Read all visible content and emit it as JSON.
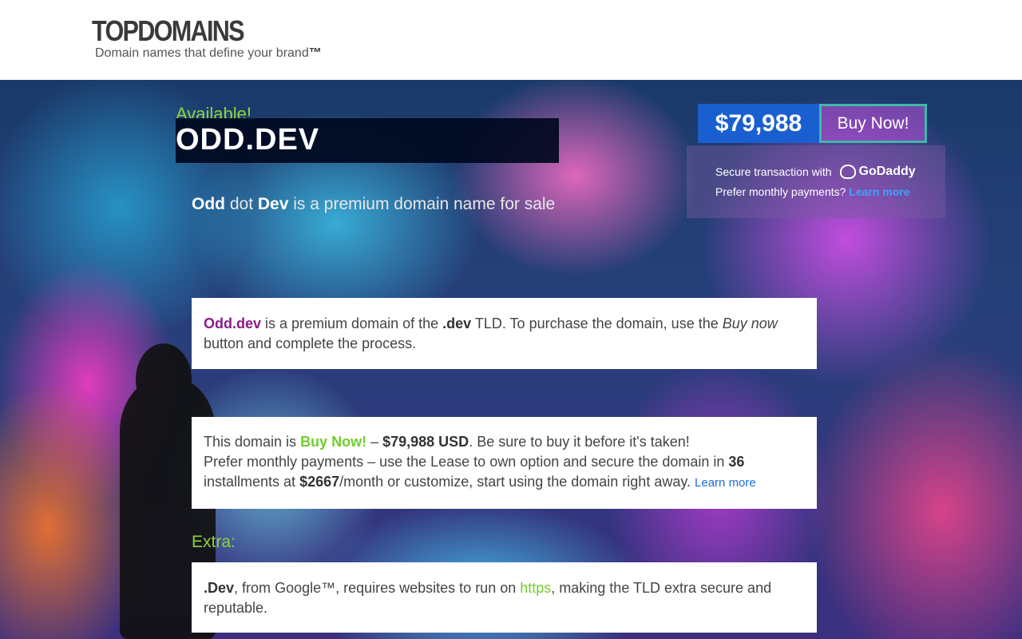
{
  "header": {
    "logo": "TOPDOMAINS",
    "tagline": "Domain names that define your brand",
    "tagline_tm": "™"
  },
  "hero": {
    "available": "Available!",
    "domain": "ODD.DEV",
    "subtitle_word1": "Odd",
    "subtitle_dot": "dot",
    "subtitle_word2": "Dev",
    "subtitle_rest": "is a premium domain name for sale"
  },
  "price": {
    "amount": "$79,988",
    "buy_label": "Buy Now!",
    "secure_text": "Secure transaction with",
    "godaddy": "GoDaddy",
    "monthly_text": "Prefer monthly payments?",
    "learn_more": "Learn more"
  },
  "card1": {
    "domain": "Odd.dev",
    "text1": "is a premium domain of the",
    "tld": ".dev",
    "text2": "TLD. To purchase the domain, use the",
    "buy_now_italic": "Buy now",
    "text3": "button and complete the process."
  },
  "card2": {
    "text1": "This domain is",
    "buy_now": "Buy Now!",
    "dash": "–",
    "price": "$79,988 USD",
    "text2": ". Be sure to buy it before it's taken!",
    "text3": "Prefer monthly payments – use the Lease to own option and secure the domain in",
    "months": "36",
    "text4": "installments at",
    "monthly": "$2667",
    "text5": "/month or customize, start using the domain right away.",
    "learn_more": "Learn more"
  },
  "extra": {
    "label": "Extra:",
    "tld": ".Dev",
    "text1": ", from",
    "google": "Google™",
    "text2": ", requires websites to run on",
    "https": "https",
    "text3": ", making the TLD extra secure and reputable."
  },
  "colors": {
    "accent_green": "#8ed43b",
    "price_blue": "#1a5fd0",
    "domain_purple": "#8a1a8a",
    "link_blue": "#1a6ed8"
  }
}
